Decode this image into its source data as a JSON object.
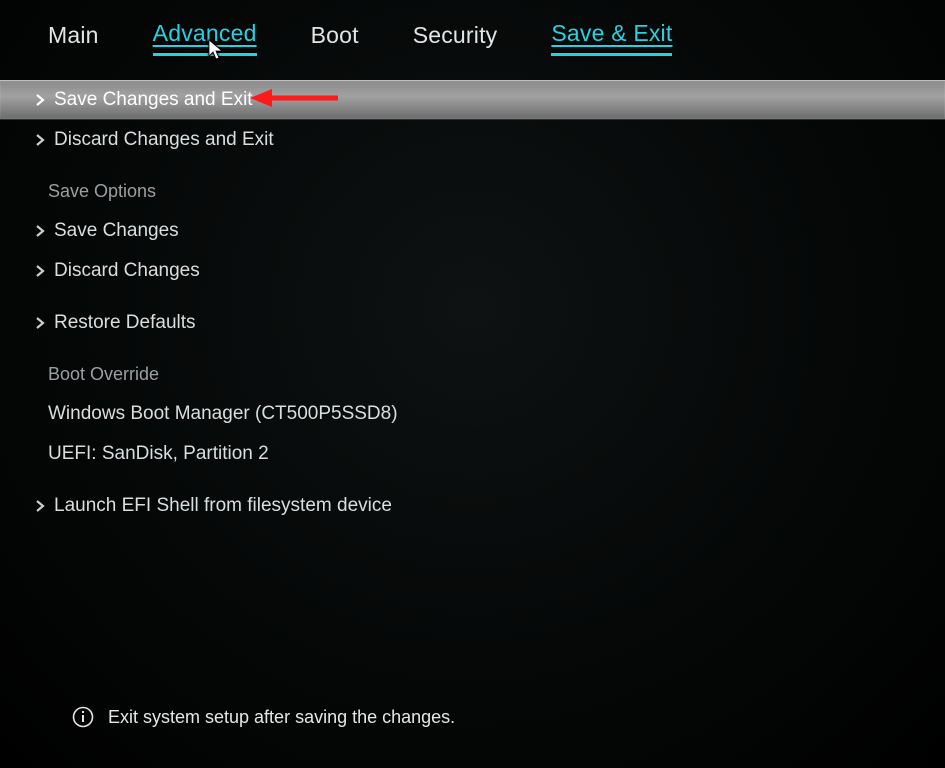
{
  "tabs": {
    "main": "Main",
    "advanced": "Advanced",
    "boot": "Boot",
    "security": "Security",
    "saveexit": "Save & Exit"
  },
  "menu": {
    "save_changes_exit": "Save Changes and Exit",
    "discard_changes_exit": "Discard Changes and Exit",
    "save_options": "Save Options",
    "save_changes": "Save Changes",
    "discard_changes": "Discard Changes",
    "restore_defaults": "Restore Defaults",
    "boot_override": "Boot Override",
    "boot_entry_1": "Windows Boot Manager (CT500P5SSD8)",
    "boot_entry_2": "UEFI: SanDisk, Partition 2",
    "launch_efi_shell": "Launch EFI Shell from filesystem device"
  },
  "footer": {
    "help_text": "Exit system setup after saving the changes."
  }
}
